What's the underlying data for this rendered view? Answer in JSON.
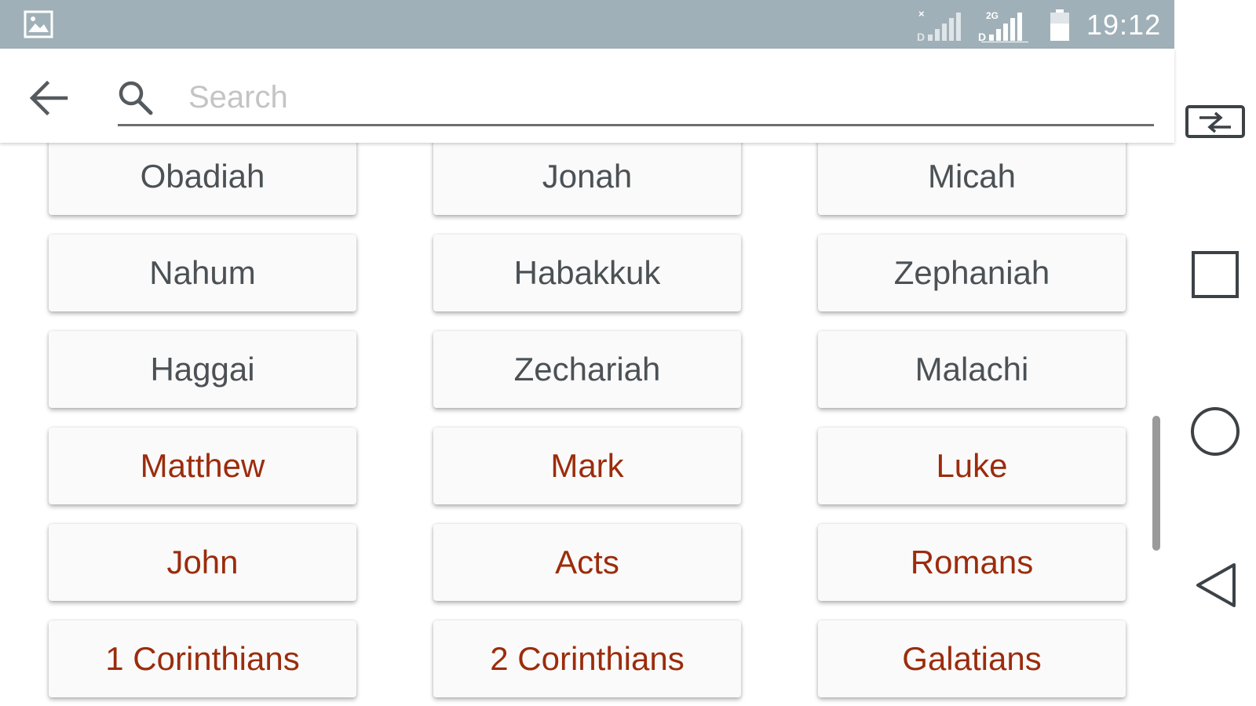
{
  "status_bar": {
    "time": "19:12",
    "background_color": "#a0b0b8",
    "icons": [
      "gallery-icon",
      "signal-no-service-icon",
      "signal-2g-icon",
      "battery-icon"
    ]
  },
  "toolbar": {
    "search_placeholder": "Search",
    "search_value": "",
    "icons": [
      "back-arrow-icon",
      "search-icon"
    ]
  },
  "books": [
    {
      "label": "Obadiah",
      "testament": "old"
    },
    {
      "label": "Jonah",
      "testament": "old"
    },
    {
      "label": "Micah",
      "testament": "old"
    },
    {
      "label": "Nahum",
      "testament": "old"
    },
    {
      "label": "Habakkuk",
      "testament": "old"
    },
    {
      "label": "Zephaniah",
      "testament": "old"
    },
    {
      "label": "Haggai",
      "testament": "old"
    },
    {
      "label": "Zechariah",
      "testament": "old"
    },
    {
      "label": "Malachi",
      "testament": "old"
    },
    {
      "label": "Matthew",
      "testament": "new"
    },
    {
      "label": "Mark",
      "testament": "new"
    },
    {
      "label": "Luke",
      "testament": "new"
    },
    {
      "label": "John",
      "testament": "new"
    },
    {
      "label": "Acts",
      "testament": "new"
    },
    {
      "label": "Romans",
      "testament": "new"
    },
    {
      "label": "1 Corinthians",
      "testament": "new"
    },
    {
      "label": "2 Corinthians",
      "testament": "new"
    },
    {
      "label": "Galatians",
      "testament": "new"
    }
  ],
  "colors": {
    "old_testament_text": "#4b5155",
    "new_testament_text": "#9b2c0c"
  },
  "nav_bar": {
    "icons": [
      "screen-rotate-icon",
      "recents-square-icon",
      "home-circle-icon",
      "back-triangle-icon"
    ]
  }
}
